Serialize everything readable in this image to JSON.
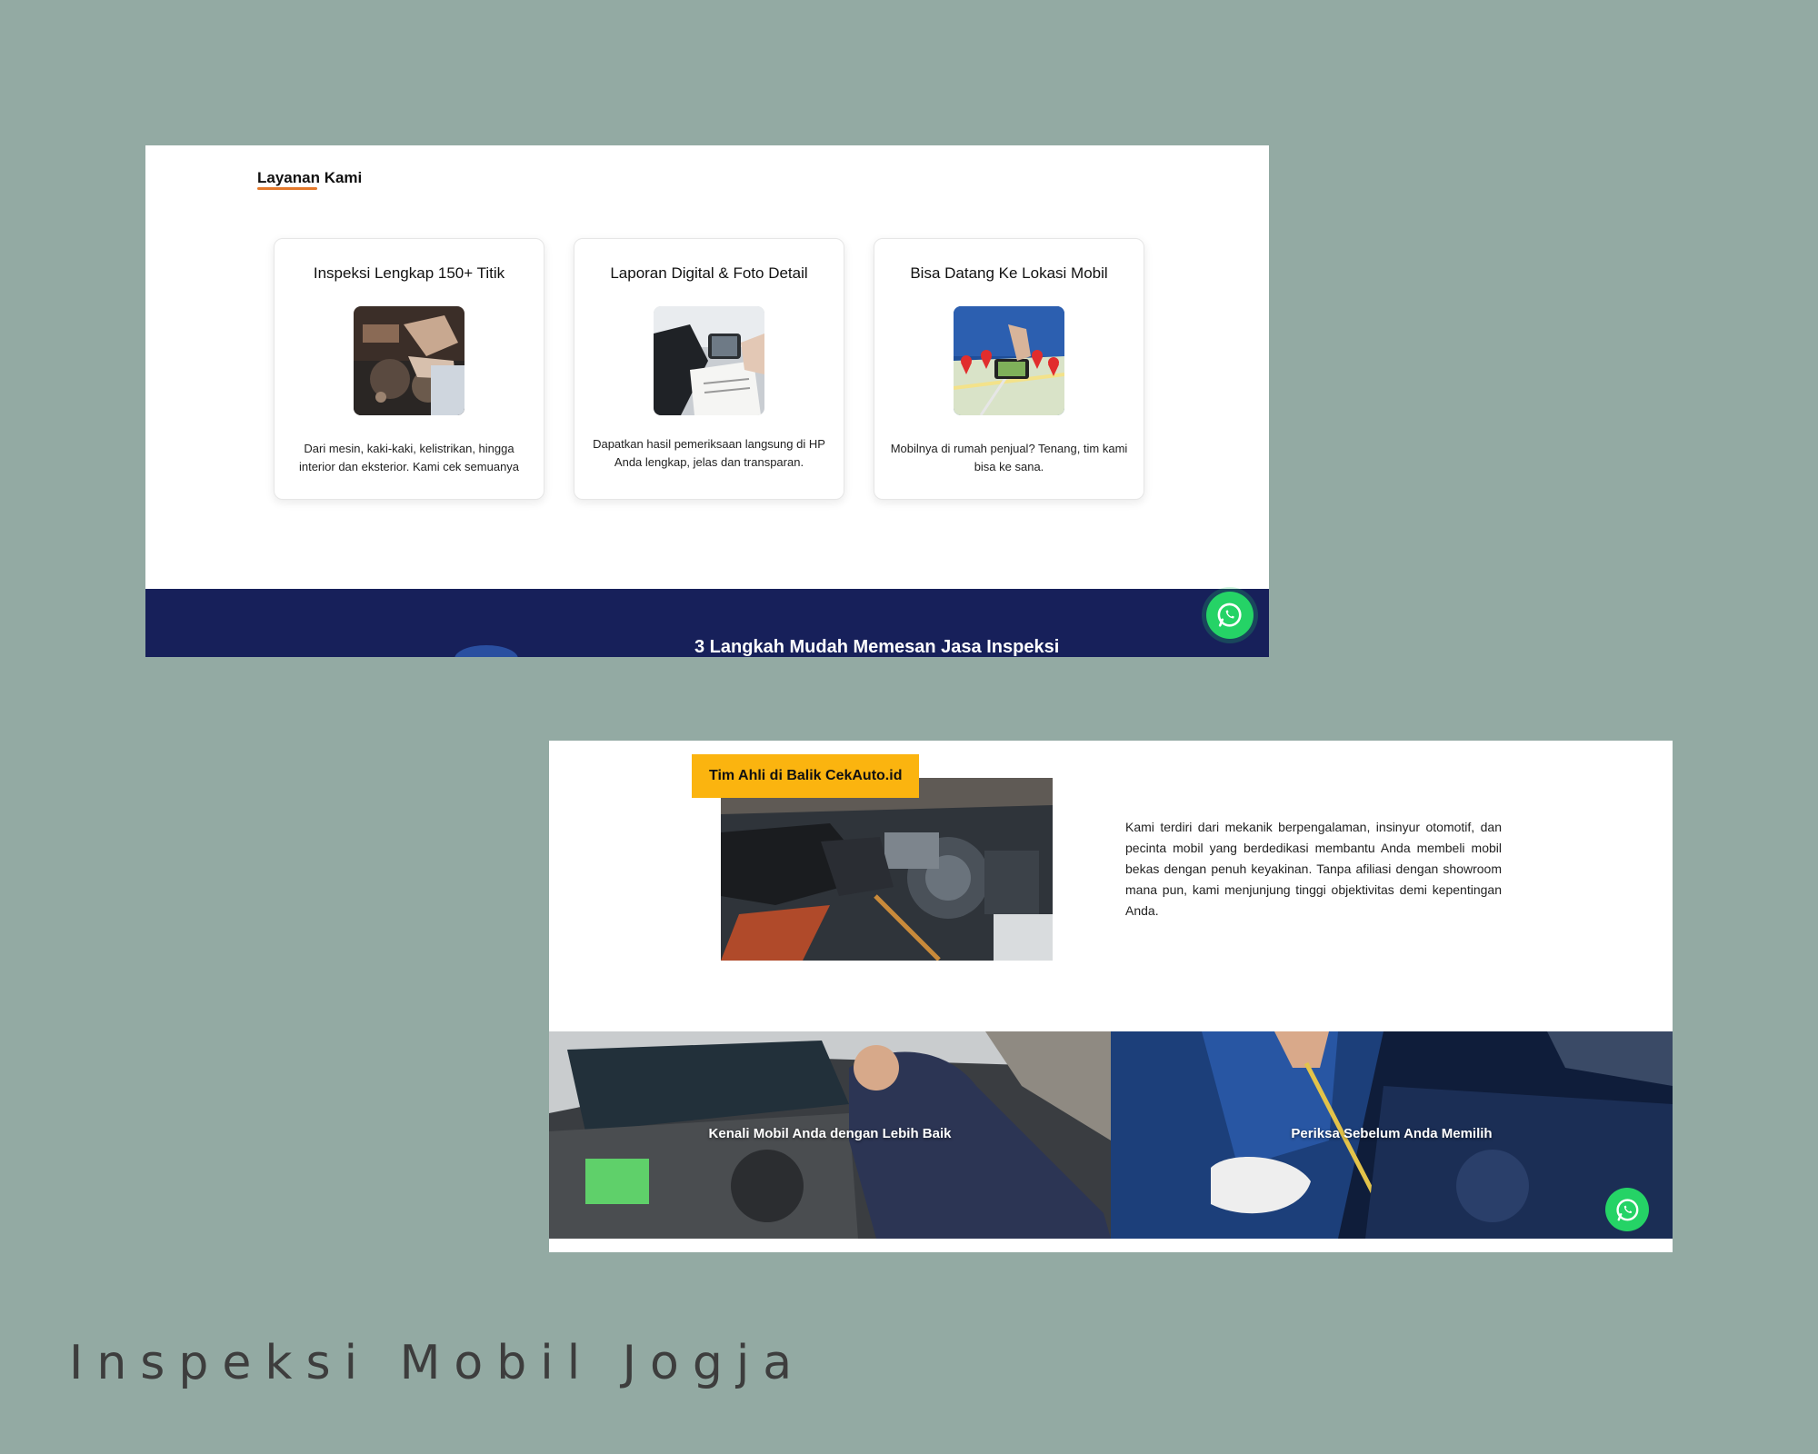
{
  "shot1": {
    "section_title": "Layanan Kami",
    "cards": [
      {
        "title": "Inspeksi Lengkap 150+ Titik",
        "image": "engine-inspection-photo",
        "description": "Dari mesin, kaki-kaki, kelistrikan, hingga interior dan eksterior. Kami cek semuanya"
      },
      {
        "title": "Laporan Digital & Foto Detail",
        "image": "phone-report-photo",
        "description": "Dapatkan hasil pemeriksaan langsung di HP Anda lengkap, jelas dan transparan."
      },
      {
        "title": "Bisa Datang Ke Lokasi Mobil",
        "image": "map-location-photo",
        "description": "Mobilnya di rumah penjual? Tenang, tim kami bisa ke sana."
      }
    ],
    "band_title": "3 Langkah Mudah Memesan Jasa Inspeksi",
    "whatsapp_icon": "whatsapp-icon"
  },
  "shot2": {
    "badge": "Tim Ahli di Balik CekAuto.id",
    "description": "Kami terdiri dari mekanik berpengalaman, insinyur otomotif, dan pecinta mobil yang berdedikasi membantu Anda membeli mobil bekas dengan penuh keyakinan. Tanpa afiliasi dengan showroom mana pun, kami menjunjung tinggi objektivitas demi kepentingan Anda.",
    "banners": [
      {
        "label": "Kenali Mobil Anda dengan Lebih Baik"
      },
      {
        "label": "Periksa Sebelum Anda Memilih"
      }
    ],
    "whatsapp_icon": "whatsapp-icon"
  },
  "caption": "Inspeksi Mobil Jogja",
  "colors": {
    "background": "#93aaa3",
    "navy": "#17205a",
    "accent_orange": "#e3792c",
    "badge_yellow": "#fbb40f",
    "whatsapp_green": "#25d366"
  }
}
